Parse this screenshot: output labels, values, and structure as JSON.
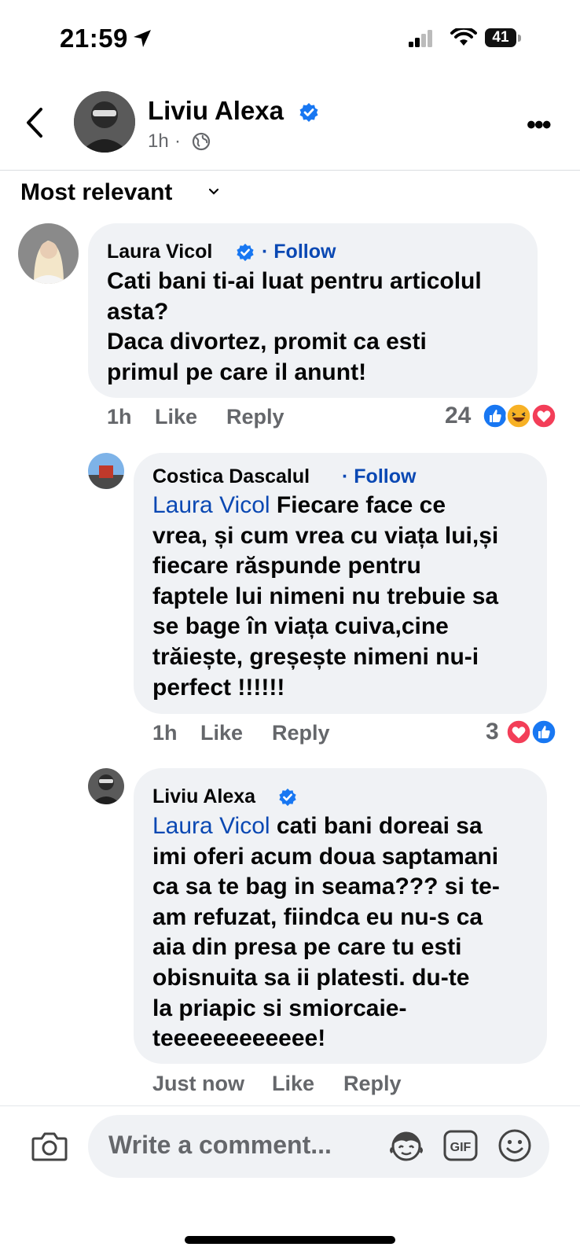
{
  "status_bar": {
    "time": "21:59",
    "battery": "41"
  },
  "post": {
    "author": "Liviu Alexa",
    "time": "1h",
    "separator": "·"
  },
  "sort": {
    "label": "Most relevant"
  },
  "comments": [
    {
      "author": "Laura Vicol",
      "follow": "· Follow",
      "text": "Cati bani ti-ai luat pentru articolul\nasta?\nDaca divortez, promit ca esti\nprimul pe care il anunt!",
      "time": "1h",
      "like": "Like",
      "reply": "Reply",
      "reaction_count": "24"
    },
    {
      "author": "Costica Dascalul",
      "follow": "· Follow",
      "mention": "Laura Vicol",
      "text": " Fiecare face ce\nvrea, și cum vrea cu viața lui,și\nfiecare răspunde pentru\nfaptele lui nimeni nu trebuie sa\nse bage în viața cuiva,cine\ntrăiește, greșește nimeni nu-i\nperfect !!!!!!",
      "time": "1h",
      "like": "Like",
      "reply": "Reply",
      "reaction_count": "3"
    },
    {
      "author": "Liviu Alexa",
      "mention": "Laura Vicol",
      "text": " cati bani doreai sa\nimi oferi acum doua saptamani\nca sa te bag in seama??? si te-\nam refuzat, fiindca eu nu-s ca\naia din presa pe care tu esti\nobisnuita sa ii platesti.   du-te\nla priapic si smiorcaie-\nteeeeeeeeeeee!",
      "time": "Just now",
      "like": "Like",
      "reply": "Reply"
    }
  ],
  "composer": {
    "placeholder": "Write a comment...",
    "gif_label": "GIF"
  },
  "colors": {
    "link_blue": "#0a48b3",
    "verified_blue": "#1877f2",
    "bubble_bg": "#f0f2f5",
    "meta_gray": "#65676b"
  }
}
